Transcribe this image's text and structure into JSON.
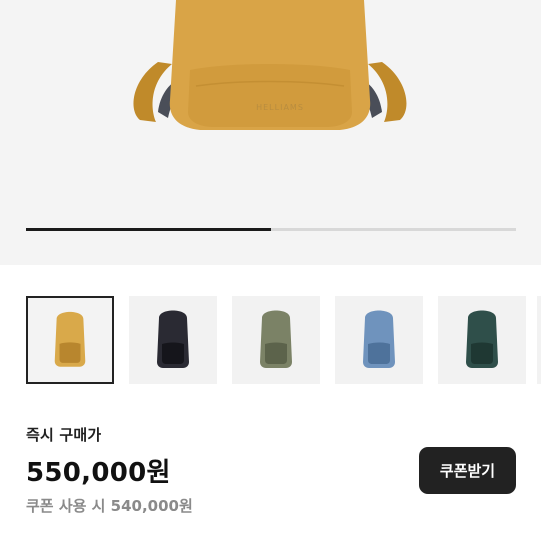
{
  "hero": {
    "brand_text": "HELLIAMS",
    "slide_progress": 0.5
  },
  "thumbnails": [
    {
      "name": "mustard",
      "color": "#d9a94a",
      "dark": "#b8862e"
    },
    {
      "name": "black",
      "color": "#2a2a33",
      "dark": "#15151b"
    },
    {
      "name": "olive",
      "color": "#7b8266",
      "dark": "#5c634b"
    },
    {
      "name": "blue",
      "color": "#6f93bd",
      "dark": "#4e729b"
    },
    {
      "name": "teal",
      "color": "#2f4f4a",
      "dark": "#1f3833"
    }
  ],
  "purchase": {
    "label": "즉시 구매가",
    "price": "550,000원",
    "coupon_price": "쿠폰 사용 시 540,000원",
    "coupon_button": "쿠폰받기"
  }
}
